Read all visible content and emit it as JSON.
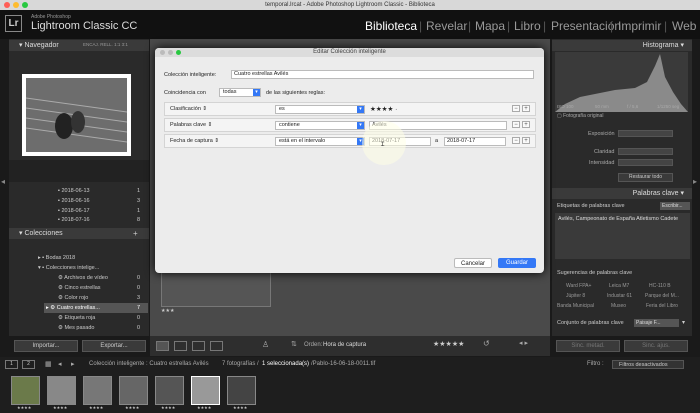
{
  "titlebar": {
    "text": "temporal.lrcat - Adobe Photoshop Lightroom Classic - Biblioteca"
  },
  "brand": {
    "logo": "Lr",
    "adobe": "Adobe Photoshop",
    "product": "Lightroom Classic CC"
  },
  "modules": [
    "Biblioteca",
    "Revelar",
    "Mapa",
    "Libro",
    "Presentación",
    "Imprimir",
    "Web"
  ],
  "left": {
    "navigator": {
      "title": "Navegador",
      "opts": [
        "ENCAJ.",
        "RELL.",
        "1:1",
        "3:1"
      ]
    },
    "folders": [
      {
        "name": "2018-06-13",
        "count": "1"
      },
      {
        "name": "2018-06-16",
        "count": "3"
      },
      {
        "name": "2018-06-17",
        "count": "1"
      },
      {
        "name": "2018-07-16",
        "count": "8"
      }
    ],
    "collections": {
      "title": "Colecciones",
      "items": [
        {
          "name": "Bodas 2018",
          "count": ""
        },
        {
          "name": "Colecciones intelige...",
          "count": ""
        },
        {
          "name": "Archivos de vídeo",
          "count": "0"
        },
        {
          "name": "Cinco estrellas",
          "count": "0"
        },
        {
          "name": "Color rojo",
          "count": "3"
        },
        {
          "name": "Cuatro estrellas...",
          "count": "7"
        },
        {
          "name": "Etiqueta roja",
          "count": "0"
        },
        {
          "name": "Mes pasado",
          "count": "0"
        }
      ]
    },
    "import": "Importar...",
    "export": "Exportar..."
  },
  "dialog": {
    "title": "Editar Colección inteligente",
    "name_label": "Colección inteligente:",
    "name_value": "Cuatro estrellas Avilés",
    "match_prefix": "Coincidencia con",
    "match_value": "todas",
    "match_suffix": "de las siguientes reglas:",
    "rules": [
      {
        "field": "Clasificación",
        "op": "es",
        "value": "★★★★ ·"
      },
      {
        "field": "Palabras clave",
        "op": "contiene",
        "value": "Avilés"
      },
      {
        "field": "Fecha de captura",
        "op": "está en el intervalo",
        "value": "2018-07-17",
        "value2": "2018-07-17",
        "and": "a"
      }
    ],
    "cancel": "Cancelar",
    "save": "Guardar"
  },
  "right": {
    "histogram": {
      "title": "Histograma",
      "iso": "ISO 100",
      "focal": "50 mm",
      "aperture": "f / 5,6",
      "speed": "1/1250 seg",
      "original": "Fotografía original"
    },
    "quick": {
      "rows": [
        "Exposición",
        "Claridad",
        "Intensidad"
      ],
      "reset": "Restaurar todo"
    },
    "keywords": {
      "title": "Palabras clave",
      "tags_label": "Etiquetas de palabras clave",
      "tags_mode": "Escribir...",
      "tags": "Avilés, Campeonato de España Atletismo Cadete"
    },
    "suggest": {
      "title": "Sugerencias de palabras clave",
      "items": [
        "Ward FPA+",
        "Leica M7",
        "HC-110 B",
        "Júpiter 8",
        "Industar 61",
        "Parque del M...",
        "Banda Municipal",
        "Museo",
        "Feria del Libro"
      ]
    },
    "kwset": {
      "label": "Conjunto de palabras clave",
      "value": "Paisaje F..."
    },
    "sync1": "Sinc. metad.",
    "sync2": "Sinc. ajus."
  },
  "toolbar": {
    "order_label": "Orden:",
    "order_value": "Hora de captura"
  },
  "status": {
    "pages": [
      "1",
      "2"
    ],
    "source": "Colección inteligente : Cuatro estrellas Avilés",
    "count": "7 fotografías /",
    "selected": "1 seleccionada(s)",
    "file": "/Pablo-16-06-18-0011.tif",
    "filter_label": "Filtro :",
    "filter_value": "Filtros desactivados"
  },
  "grid": {
    "stars": "★★★"
  },
  "filmstrip": {
    "stars": "★★★★"
  }
}
